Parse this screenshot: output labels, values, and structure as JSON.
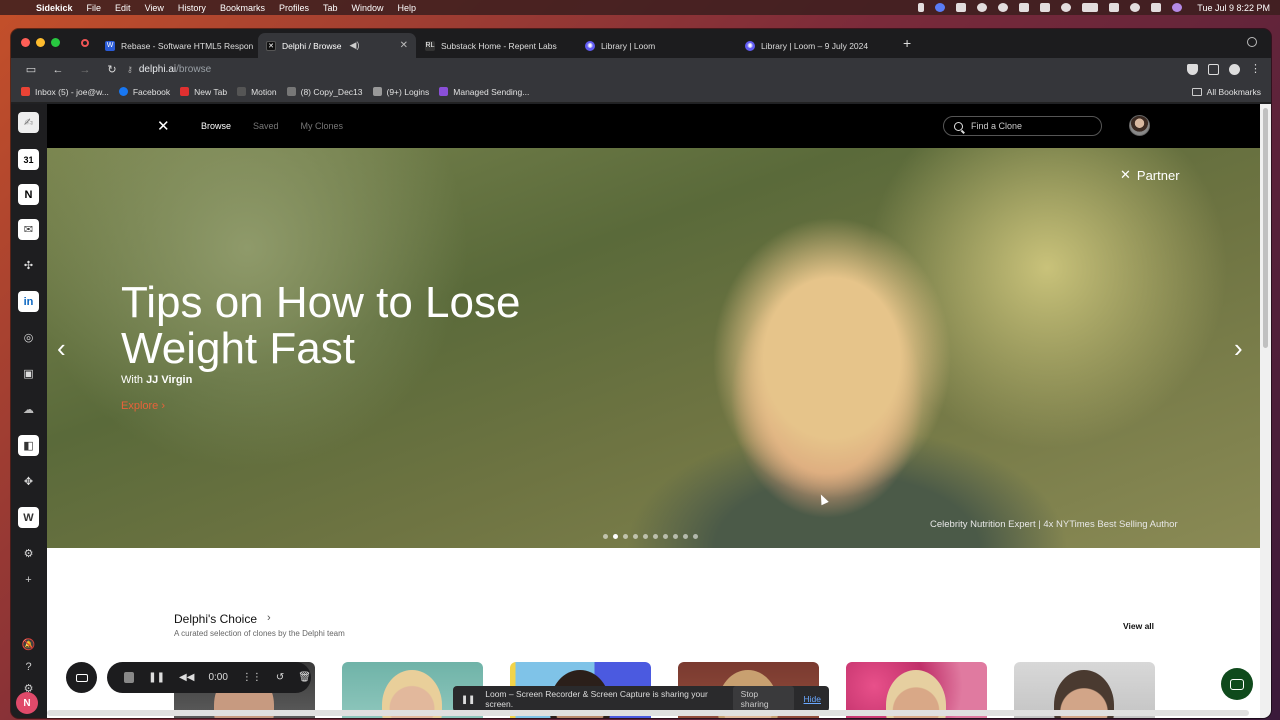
{
  "menubar": {
    "app": "Sidekick",
    "items": [
      "File",
      "Edit",
      "View",
      "History",
      "Bookmarks",
      "Profiles",
      "Tab",
      "Window",
      "Help"
    ],
    "clock": "Tue Jul 9  8:22 PM"
  },
  "tabs": [
    {
      "title": "Rebase - Software HTML5 Respon",
      "icon": "w-icon",
      "color": "#2a5bd7"
    },
    {
      "title": "Delphi / Browse",
      "icon": "delphi-icon",
      "color": "#111111"
    },
    {
      "title": "Substack Home - Repent Labs",
      "icon": "rl-icon",
      "color": "#333333"
    },
    {
      "title": "Library | Loom",
      "icon": "loom-icon",
      "color": "#625df5"
    },
    {
      "title": "Library | Loom – 9 July 2024",
      "icon": "loom-icon",
      "color": "#625df5"
    }
  ],
  "address": {
    "domain": "delphi.ai",
    "path": "/browse"
  },
  "bookmarks": [
    {
      "label": "Inbox (5) - joe@w...",
      "color": "#ea4335"
    },
    {
      "label": "Facebook",
      "color": "#1877f2"
    },
    {
      "label": "New Tab",
      "color": "#e03030"
    },
    {
      "label": "Motion",
      "color": "#333333"
    },
    {
      "label": "(8) Copy_Dec13",
      "color": "#777777"
    },
    {
      "label": "(9+) Logins",
      "color": "#999999"
    },
    {
      "label": "Managed Sending...",
      "color": "#8a4fd8"
    }
  ],
  "bookmarks_all": "All Bookmarks",
  "site": {
    "nav": [
      "Browse",
      "Saved",
      "My Clones"
    ],
    "search_placeholder": "Find a Clone"
  },
  "hero": {
    "title": "Tips on How to Lose Weight Fast",
    "with_prefix": "With",
    "with_name": "JJ Virgin",
    "explore": "Explore",
    "partner": "Partner",
    "caption": "Celebrity Nutrition Expert | 4x NYTimes Best Selling Author",
    "dots_total": 10,
    "dots_active": 2
  },
  "choice": {
    "title": "Delphi's Choice",
    "subtitle": "A curated selection of clones by the Delphi team",
    "view_all": "View all"
  },
  "loom": {
    "timer": "0:00",
    "banner": "Loom – Screen Recorder & Screen Capture is sharing your screen.",
    "stop_sharing": "Stop sharing",
    "hide": "Hide"
  },
  "colors": {
    "accent": "#e8623a",
    "page_bg": "#ffffff",
    "header_bg": "#000000"
  }
}
